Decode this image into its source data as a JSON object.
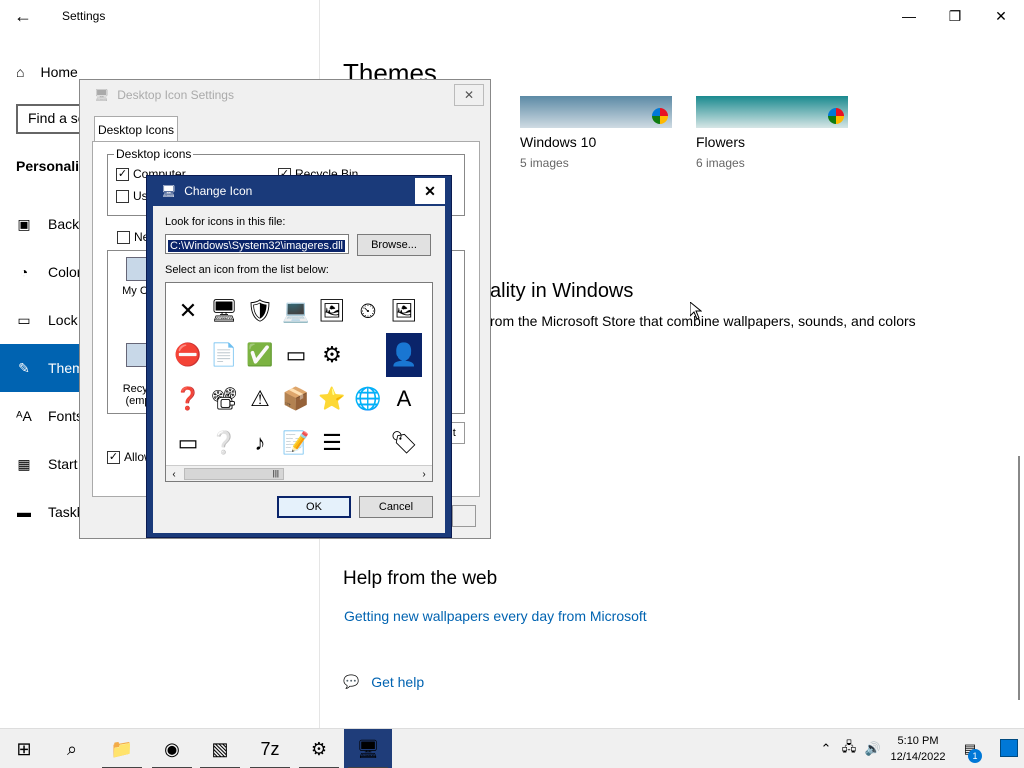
{
  "settings": {
    "app_title": "Settings",
    "nav": {
      "home": "Home",
      "search_placeholder": "Find a se",
      "section": "Personaliz",
      "items": [
        {
          "label": "Backg",
          "icon": "image-icon"
        },
        {
          "label": "Color",
          "icon": "palette-icon"
        },
        {
          "label": "Lock",
          "icon": "lock-screen-icon"
        },
        {
          "label": "Them",
          "icon": "themes-icon",
          "active": true
        },
        {
          "label": "Fonts",
          "icon": "fonts-icon"
        },
        {
          "label": "Start",
          "icon": "start-icon"
        },
        {
          "label": "Taskb",
          "icon": "taskbar-icon"
        }
      ]
    },
    "content": {
      "heading": "Themes",
      "themes": [
        {
          "name": "Windows 10",
          "count": "5 images"
        },
        {
          "name": "Flowers",
          "count": "6 images"
        }
      ],
      "personality_heading": "ality in Windows",
      "personality_desc": "rom the Microsoft Store that combine wallpapers, sounds, and colors",
      "help_heading": "Help from the web",
      "help_link": "Getting new wallpapers every day from Microsoft",
      "get_help": "Get help"
    }
  },
  "desktop_icon_settings": {
    "title": "Desktop Icon Settings",
    "tab": "Desktop Icons",
    "group_label": "Desktop icons",
    "checks": [
      {
        "label": "Computer",
        "checked": true
      },
      {
        "label": "Use",
        "checked": false
      },
      {
        "label": "Ne",
        "checked": false
      },
      {
        "label": "Recycle Bin",
        "checked": true
      }
    ],
    "icons": [
      {
        "label": "My Co"
      },
      {
        "label": "Recyc\n(emp"
      }
    ],
    "restore_label": "lt",
    "allow_label": "Allow"
  },
  "change_icon": {
    "title": "Change Icon",
    "file_label": "Look for icons in this file:",
    "file_value": "C:\\Windows\\System32\\imageres.dll",
    "browse": "Browse...",
    "list_label": "Select an icon from the list below:",
    "ok": "OK",
    "cancel": "Cancel",
    "grid_icons": [
      "✕",
      "🖥",
      "🛡",
      "💻",
      "🖼",
      "⏲",
      "🖼",
      "⛔",
      "📄",
      "✅",
      "▭",
      "⚙",
      "",
      "👤",
      "❓",
      "📽",
      "⚠",
      "📦",
      "⭐",
      "🌐",
      "A",
      "▭",
      "❔",
      "♪",
      "📝",
      "☰",
      "",
      "🏷"
    ],
    "selected_index": 13
  },
  "taskbar": {
    "time": "5:10 PM",
    "date": "12/14/2022",
    "notification_count": "1"
  }
}
